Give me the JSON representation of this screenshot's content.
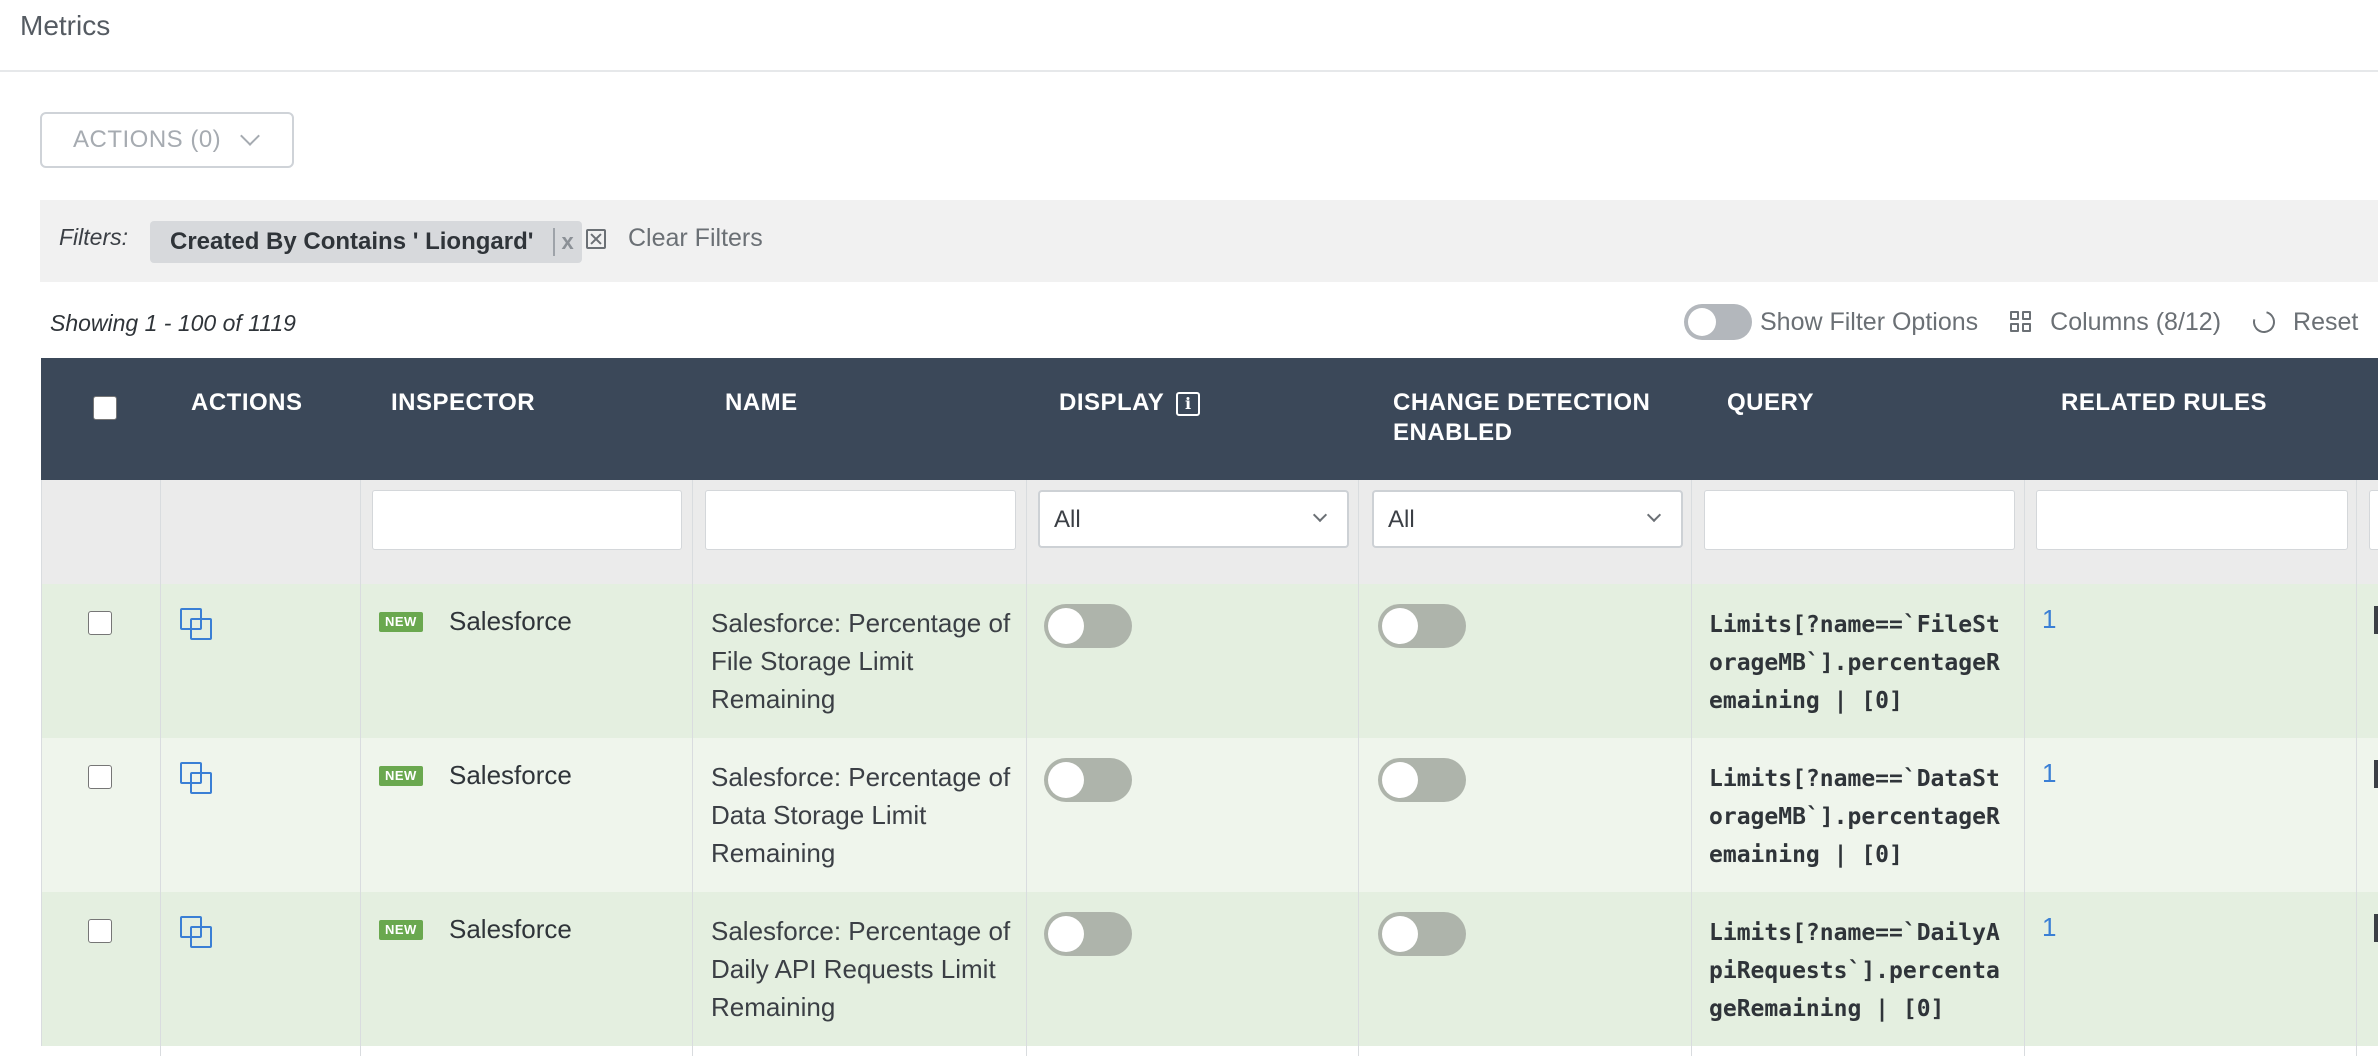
{
  "page": {
    "title": "Metrics"
  },
  "actions_button": {
    "label": "ACTIONS (0)"
  },
  "filters": {
    "label": "Filters:",
    "chips": [
      {
        "text": "Created By Contains ' Liongard'",
        "remove": "x"
      }
    ],
    "clear_label": "Clear Filters"
  },
  "toolbar": {
    "showing": "Showing 1 - 100 of 1119",
    "show_filter_options": "Show Filter Options",
    "columns": "Columns (8/12)",
    "reset": "Reset"
  },
  "columns": {
    "actions": "ACTIONS",
    "inspector": "INSPECTOR",
    "name": "NAME",
    "display": "DISPLAY",
    "display_info": "i",
    "change_detection_line1": "CHANGE DETECTION",
    "change_detection_line2": "ENABLED",
    "query": "QUERY",
    "related_rules": "RELATED RULES"
  },
  "column_filters": {
    "display": "All",
    "change_detection": "All"
  },
  "badge_label": "NEW",
  "rows": [
    {
      "inspector": "Salesforce",
      "name": "Salesforce: Percentage of File Storage Limit Remaining",
      "display_enabled": false,
      "change_detection_enabled": false,
      "query": "Limits[?name==`FileStorageMB`].percentageRemaining | [0]",
      "related_rules": "1"
    },
    {
      "inspector": "Salesforce",
      "name": "Salesforce: Percentage of Data Storage Limit Remaining",
      "display_enabled": false,
      "change_detection_enabled": false,
      "query": "Limits[?name==`DataStorageMB`].percentageRemaining | [0]",
      "related_rules": "1"
    },
    {
      "inspector": "Salesforce",
      "name": "Salesforce: Percentage of Daily API Requests Limit Remaining",
      "display_enabled": false,
      "change_detection_enabled": false,
      "query": "Limits[?name==`DailyApiRequests`].percentageRemaining | [0]",
      "related_rules": "1"
    }
  ]
}
